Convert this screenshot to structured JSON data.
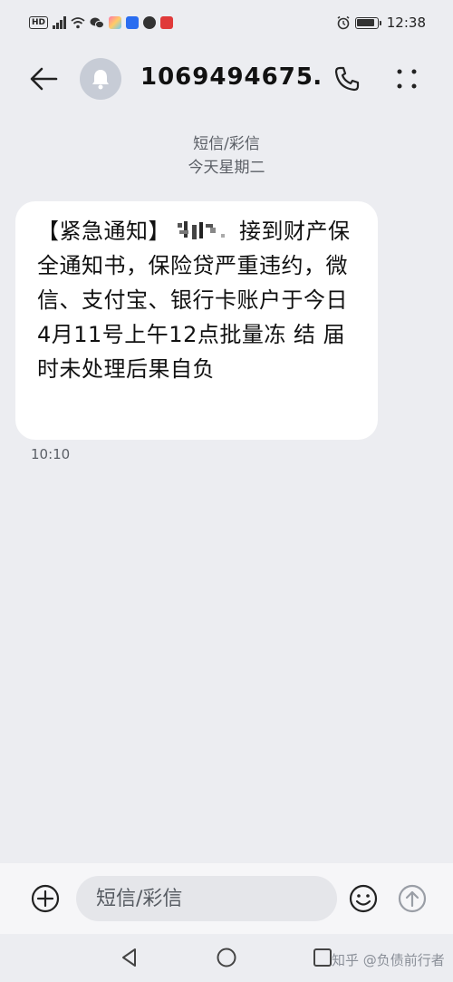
{
  "status_bar": {
    "hd_label": "HD",
    "time": "12:38",
    "icons": [
      "hd-icon",
      "signal-icon",
      "wifi-icon",
      "wechat-icon",
      "app-icon",
      "app-icon",
      "app-icon",
      "app-icon",
      "alarm-icon",
      "battery-icon"
    ],
    "battery_level": 0.9
  },
  "header": {
    "title": "1069494675…",
    "icons": [
      "back-arrow-icon",
      "bell-icon",
      "phone-icon",
      "more-vertical-icon"
    ]
  },
  "conversation": {
    "channel": "短信/彩信",
    "date": "今天星期二",
    "message": {
      "text_before": "【紧急通知】",
      "text_after": "接到财产保全通知书，保险贷严重违约，微信、支付宝、银行卡账户于今日4月11号上午12点批量冻 结 届时未处理后果自负",
      "time": "10:10"
    }
  },
  "input_bar": {
    "placeholder": "短信/彩信",
    "icons": [
      "add-icon",
      "emoji-icon",
      "send-icon"
    ]
  },
  "nav_bar": {
    "icons": [
      "nav-back-icon",
      "nav-home-icon",
      "nav-recent-icon"
    ]
  },
  "watermark": "知乎 @负债前行者",
  "colors": {
    "background": "#ecedf1",
    "bubble": "#ffffff",
    "input": "#e5e6ea",
    "avatar": "#c7ccd6"
  }
}
